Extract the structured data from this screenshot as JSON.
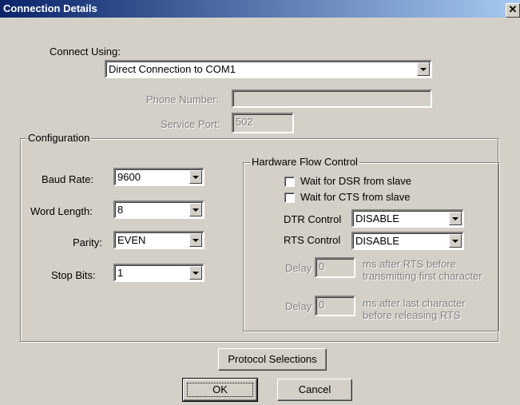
{
  "window": {
    "title": "Connection Details",
    "close_glyph": "✕"
  },
  "connect_using": {
    "label": "Connect Using:",
    "value": "Direct Connection to COM1"
  },
  "phone_number": {
    "label": "Phone Number:",
    "value": ""
  },
  "service_port": {
    "label": "Service Port:",
    "value": "502"
  },
  "configuration": {
    "title": "Configuration",
    "baud_rate": {
      "label": "Baud Rate:",
      "value": "9600"
    },
    "word_length": {
      "label": "Word Length:",
      "value": "8"
    },
    "parity": {
      "label": "Parity:",
      "value": "EVEN"
    },
    "stop_bits": {
      "label": "Stop Bits:",
      "value": "1"
    }
  },
  "hardware_flow": {
    "title": "Hardware Flow Control",
    "dsr_label": "Wait for DSR from slave",
    "cts_label": "Wait for CTS from slave",
    "dtr": {
      "label": "DTR Control",
      "value": "DISABLE"
    },
    "rts": {
      "label": "RTS Control",
      "value": "DISABLE"
    },
    "delay1": {
      "label": "Delay",
      "value": "0",
      "desc_line1": "ms after RTS before",
      "desc_line2": "transmitting first character"
    },
    "delay2": {
      "label": "Delay",
      "value": "0",
      "desc_line1": "ms after last character",
      "desc_line2": "before releasing RTS"
    }
  },
  "buttons": {
    "protocol": "Protocol Selections",
    "ok": "OK",
    "cancel": "Cancel"
  }
}
